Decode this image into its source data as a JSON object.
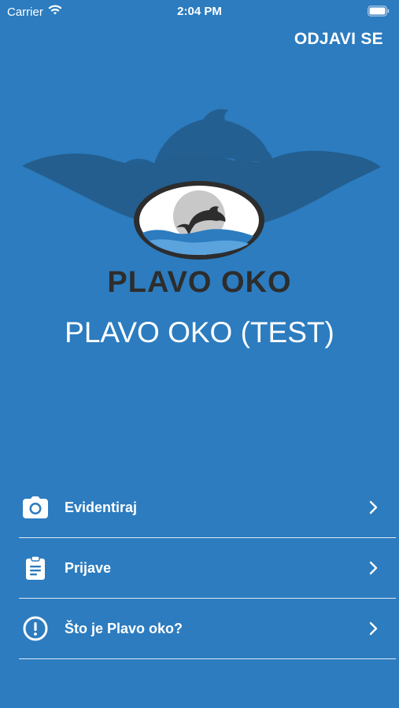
{
  "status_bar": {
    "carrier": "Carrier",
    "time": "2:04 PM"
  },
  "header": {
    "logout_label": "ODJAVI SE"
  },
  "logo": {
    "text": "PLAVO OKO"
  },
  "app_title": "PLAVO OKO (TEST)",
  "menu": {
    "items": [
      {
        "label": "Evidentiraj",
        "icon": "camera-icon"
      },
      {
        "label": "Prijave",
        "icon": "clipboard-icon"
      },
      {
        "label": "Što je Plavo oko?",
        "icon": "info-icon"
      }
    ]
  },
  "colors": {
    "background": "#2c7cbf",
    "logo_dark": "#2d2d2d",
    "logo_shadow": "#235e8e"
  }
}
